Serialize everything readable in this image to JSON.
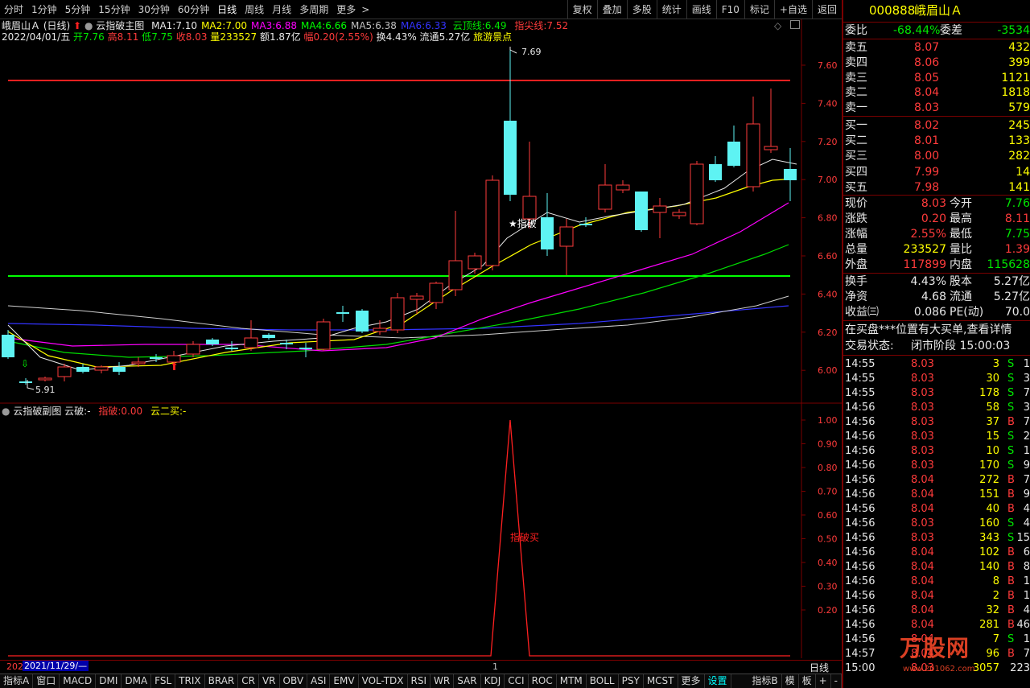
{
  "toolbar": {
    "periods": [
      "分时",
      "1分钟",
      "5分钟",
      "15分钟",
      "30分钟",
      "60分钟",
      "日线",
      "周线",
      "月线",
      "多周期",
      "更多"
    ],
    "active_period": "日线",
    "buttons": [
      "复权",
      "叠加",
      "多股",
      "统计",
      "画线",
      "F10",
      "标记",
      "+自选",
      "返回"
    ]
  },
  "main_chart": {
    "stock_name": "峨眉山Ａ",
    "period": "(日线)",
    "indicator_name": "云指破主图",
    "ma": [
      {
        "label": "MA1:",
        "value": "7.10",
        "color": "#e8e8e8"
      },
      {
        "label": "MA2:",
        "value": "7.00",
        "color": "#ffff00"
      },
      {
        "label": "MA3:",
        "value": "6.88",
        "color": "#ff00ff"
      },
      {
        "label": "MA4:",
        "value": "6.66",
        "color": "#00ff00"
      },
      {
        "label": "MA5:",
        "value": "6.38",
        "color": "#c0c0c0"
      },
      {
        "label": "MA6:",
        "value": "6.33",
        "color": "#3333ff"
      }
    ],
    "cloud_top_label": "云顶线:",
    "cloud_top_value": "6.49",
    "tip_line_label": "指尖线:",
    "tip_line_value": "7.52",
    "date": "2022/04/01/五",
    "open_label": "开",
    "open": "7.76",
    "high_label": "高",
    "high": "8.11",
    "low_label": "低",
    "low": "7.75",
    "close_label": "收",
    "close": "8.03",
    "vol_label": "量",
    "vol": "233527",
    "amount_label": "额",
    "amount": "1.87亿",
    "change_label": "幅",
    "change": "0.20(2.55%)",
    "turnover_label": "换",
    "turnover": "4.43%",
    "float_label": "流通",
    "float": "5.27亿",
    "sector": "旅游景点",
    "peak_label": "7.69",
    "trough_label": "5.91",
    "signal_label": "★指破",
    "y_ticks": [
      "7.60",
      "7.40",
      "7.20",
      "7.00",
      "6.80",
      "6.60",
      "6.40",
      "6.20",
      "6.00"
    ]
  },
  "sub_chart": {
    "title": "云指破副图",
    "cloud_break_label": "云破:",
    "cloud_break_value": "-",
    "tip_break_label": "指破:",
    "tip_break_value": "0.00",
    "cloud_second_label": "云二买:",
    "cloud_second_value": "-",
    "signal_text": "指破买",
    "y_ticks": [
      "1.00",
      "0.90",
      "0.80",
      "0.70",
      "0.60",
      "0.50",
      "0.40",
      "0.30",
      "0.20"
    ]
  },
  "date_axis": {
    "left_label": "202",
    "cursor_date": "2021/11/29/—",
    "mark": "1",
    "period_label": "日线"
  },
  "tabs": [
    "指标A",
    "窗口",
    "MACD",
    "DMI",
    "DMA",
    "FSL",
    "TRIX",
    "BRAR",
    "CR",
    "VR",
    "OBV",
    "ASI",
    "EMV",
    "VOL-TDX",
    "RSI",
    "WR",
    "SAR",
    "KDJ",
    "CCI",
    "ROC",
    "MTM",
    "BOLL",
    "PSY",
    "MCST",
    "更多",
    "设置"
  ],
  "tabs_right": [
    "指标B",
    "模",
    "板",
    "+",
    "-"
  ],
  "quote": {
    "code": "000888",
    "name": "峨眉山Ａ",
    "wb_label": "委比",
    "wb_value": "-68.44%",
    "wc_label": "委差",
    "wc_value": "-3534",
    "asks": [
      {
        "label": "卖五",
        "price": "8.07",
        "vol": "432"
      },
      {
        "label": "卖四",
        "price": "8.06",
        "vol": "399"
      },
      {
        "label": "卖三",
        "price": "8.05",
        "vol": "1121"
      },
      {
        "label": "卖二",
        "price": "8.04",
        "vol": "1818"
      },
      {
        "label": "卖一",
        "price": "8.03",
        "vol": "579"
      }
    ],
    "bids": [
      {
        "label": "买一",
        "price": "8.02",
        "vol": "245"
      },
      {
        "label": "买二",
        "price": "8.01",
        "vol": "133"
      },
      {
        "label": "买三",
        "price": "8.00",
        "vol": "282"
      },
      {
        "label": "买四",
        "price": "7.99",
        "vol": "14"
      },
      {
        "label": "买五",
        "price": "7.98",
        "vol": "141"
      }
    ],
    "stats": [
      {
        "l1": "现价",
        "v1": "8.03",
        "c1": "red",
        "l2": "今开",
        "v2": "7.76",
        "c2": "green"
      },
      {
        "l1": "涨跌",
        "v1": "0.20",
        "c1": "red",
        "l2": "最高",
        "v2": "8.11",
        "c2": "red"
      },
      {
        "l1": "涨幅",
        "v1": "2.55%",
        "c1": "red",
        "l2": "最低",
        "v2": "7.75",
        "c2": "green"
      },
      {
        "l1": "总量",
        "v1": "233527",
        "c1": "yellow",
        "l2": "量比",
        "v2": "1.39",
        "c2": "red"
      },
      {
        "l1": "外盘",
        "v1": "117899",
        "c1": "red",
        "l2": "内盘",
        "v2": "115628",
        "c2": "green"
      }
    ],
    "fund": [
      {
        "l1": "换手",
        "v1": "4.43%",
        "l2": "股本",
        "v2": "5.27亿"
      },
      {
        "l1": "净资",
        "v1": "4.68",
        "l2": "流通",
        "v2": "5.27亿"
      },
      {
        "l1": "收益㈢",
        "v1": "0.086",
        "l2": "PE(动)",
        "v2": "70.0"
      }
    ],
    "notice": "在买盘***位置有大买单,查看详情",
    "status_label": "交易状态:",
    "status_value": "闭市阶段 15:00:03",
    "trades": [
      {
        "t": "14:55",
        "p": "8.03",
        "v": "3",
        "s": "S",
        "n": "1"
      },
      {
        "t": "14:55",
        "p": "8.03",
        "v": "30",
        "s": "S",
        "n": "3"
      },
      {
        "t": "14:55",
        "p": "8.03",
        "v": "178",
        "s": "S",
        "n": "7"
      },
      {
        "t": "14:56",
        "p": "8.03",
        "v": "58",
        "s": "S",
        "n": "3"
      },
      {
        "t": "14:56",
        "p": "8.03",
        "v": "37",
        "s": "B",
        "n": "7"
      },
      {
        "t": "14:56",
        "p": "8.03",
        "v": "15",
        "s": "S",
        "n": "2"
      },
      {
        "t": "14:56",
        "p": "8.03",
        "v": "10",
        "s": "S",
        "n": "1"
      },
      {
        "t": "14:56",
        "p": "8.03",
        "v": "170",
        "s": "S",
        "n": "9"
      },
      {
        "t": "14:56",
        "p": "8.04",
        "v": "272",
        "s": "B",
        "n": "7"
      },
      {
        "t": "14:56",
        "p": "8.04",
        "v": "151",
        "s": "B",
        "n": "9"
      },
      {
        "t": "14:56",
        "p": "8.04",
        "v": "40",
        "s": "B",
        "n": "4"
      },
      {
        "t": "14:56",
        "p": "8.03",
        "v": "160",
        "s": "S",
        "n": "4"
      },
      {
        "t": "14:56",
        "p": "8.03",
        "v": "343",
        "s": "S",
        "n": "15"
      },
      {
        "t": "14:56",
        "p": "8.04",
        "v": "102",
        "s": "B",
        "n": "6"
      },
      {
        "t": "14:56",
        "p": "8.04",
        "v": "140",
        "s": "B",
        "n": "8"
      },
      {
        "t": "14:56",
        "p": "8.04",
        "v": "8",
        "s": "B",
        "n": "1"
      },
      {
        "t": "14:56",
        "p": "8.04",
        "v": "2",
        "s": "B",
        "n": "1"
      },
      {
        "t": "14:56",
        "p": "8.04",
        "v": "32",
        "s": "B",
        "n": "4"
      },
      {
        "t": "14:56",
        "p": "8.04",
        "v": "281",
        "s": "B",
        "n": "46"
      },
      {
        "t": "14:56",
        "p": "8.04",
        "v": "7",
        "s": "S",
        "n": "1"
      },
      {
        "t": "14:57",
        "p": "8.04",
        "v": "96",
        "s": "B",
        "n": "7"
      },
      {
        "t": "15:00",
        "p": "8.03",
        "v": "3057",
        "s": "",
        "n": "223"
      }
    ],
    "watermark": "万股网",
    "watermark_url": "www.201062.com"
  },
  "colors": {
    "up": "#ff3b3b",
    "down": "#00ffff",
    "grid_border": "#7a0000",
    "tip_line": "#ff2020",
    "cloud_top": "#00ff00"
  }
}
